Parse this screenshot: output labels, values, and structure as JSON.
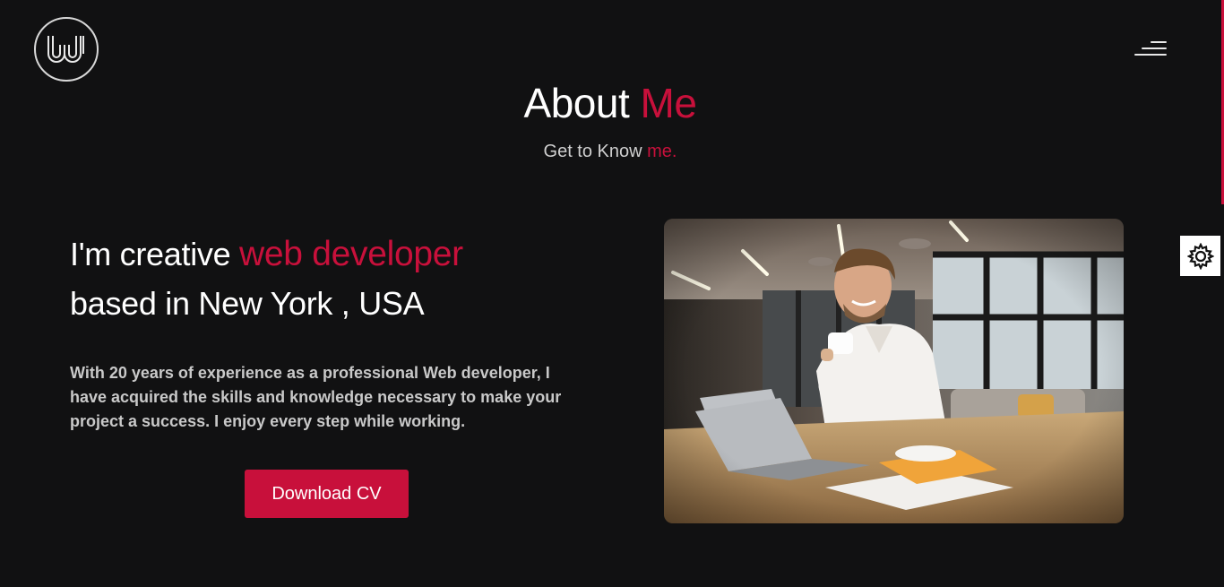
{
  "header": {
    "logo_icon": "w-monogram-logo",
    "menu_icon": "hamburger-menu-icon"
  },
  "section": {
    "title_main": "About",
    "title_accent": "Me",
    "subtitle_main": "Get to Know",
    "subtitle_accent": "me."
  },
  "about": {
    "line1_main": "I'm creative",
    "line1_accent": "web developer",
    "line2": "based in New York , USA",
    "bio": "With 20 years of experience as a professional Web developer, I have acquired the skills and knowledge necessary to make your project a success. I enjoy every step while working.",
    "download_label": "Download CV"
  },
  "photo": {
    "alt": "smiling man with coffee cup at laptop in office"
  },
  "settings": {
    "icon": "gear-icon"
  },
  "colors": {
    "background": "#111112",
    "accent": "#c8103b",
    "text": "#ffffff",
    "muted_text": "#c9c9c9"
  }
}
